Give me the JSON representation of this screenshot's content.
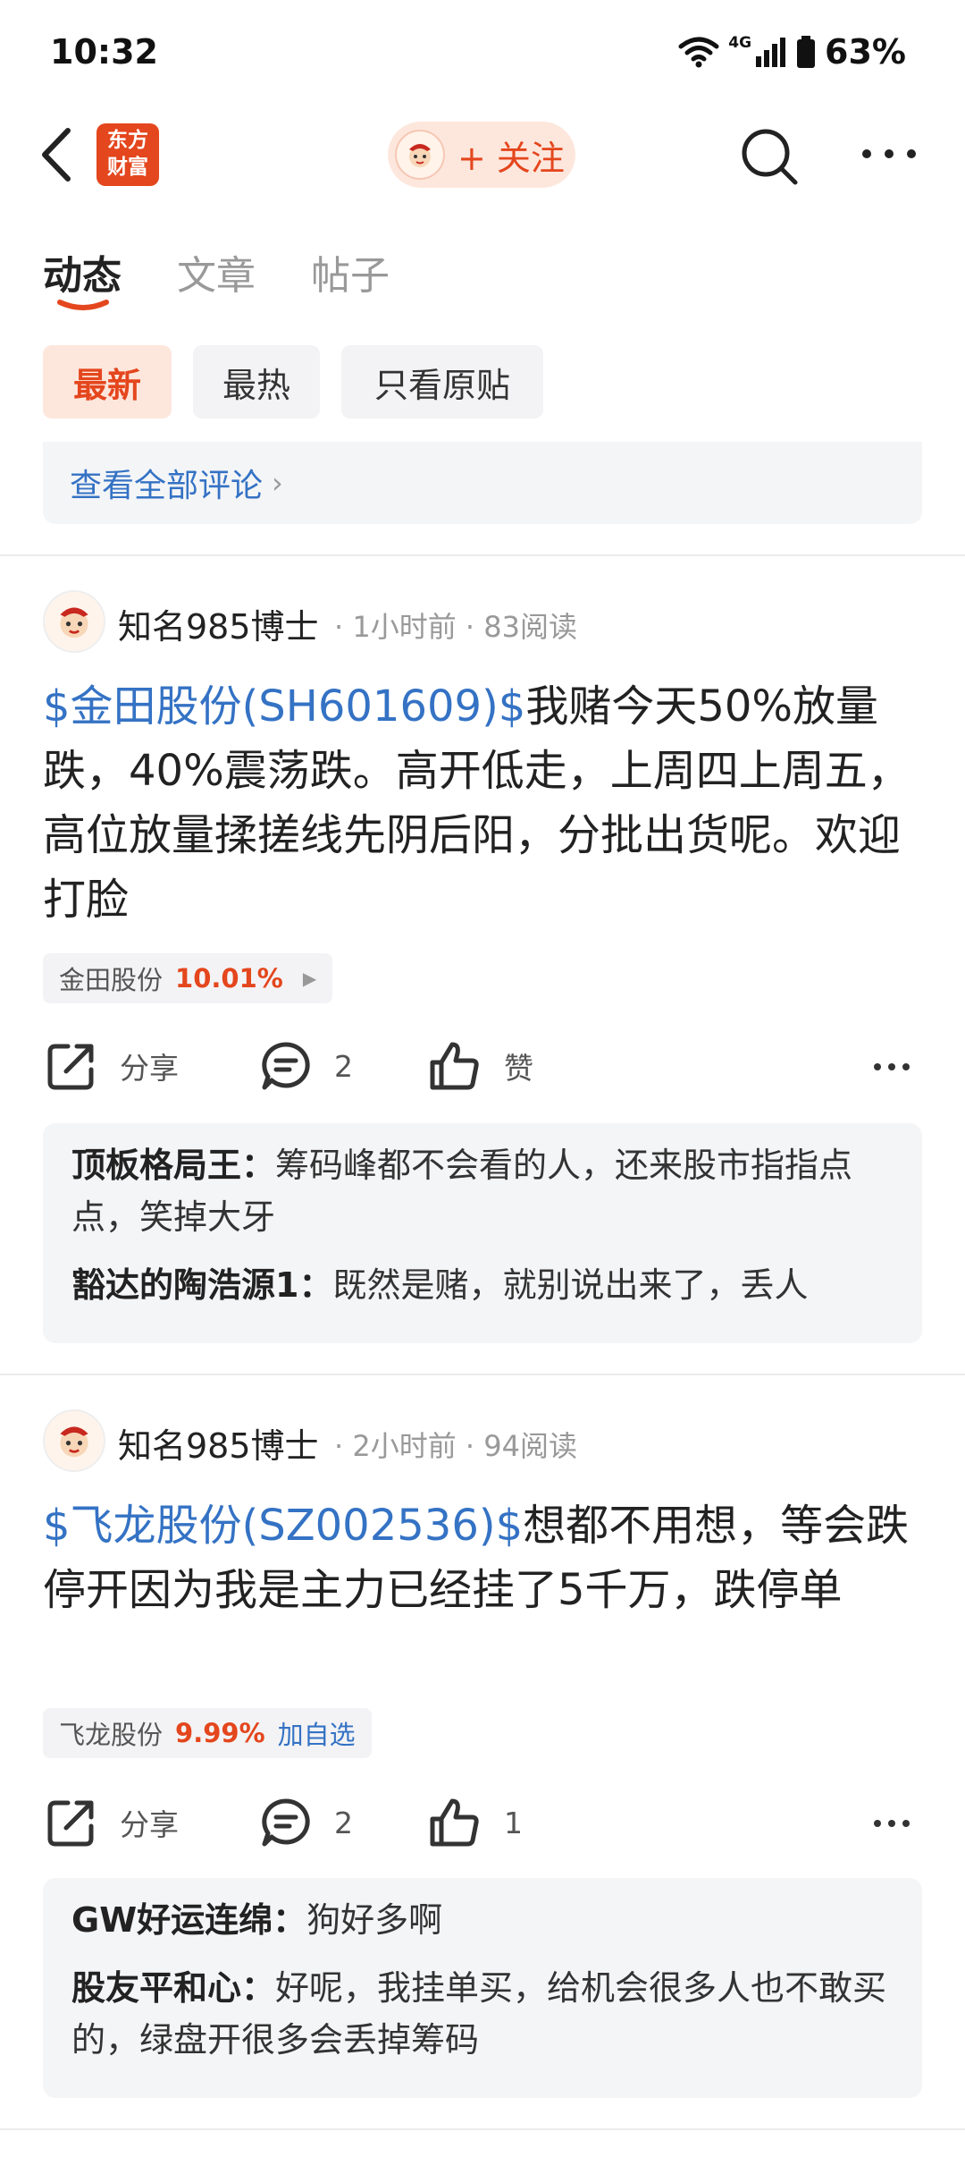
{
  "status_bar": {
    "time": "10:32",
    "network": "4G",
    "battery": "63%"
  },
  "header": {
    "logo_text_line1": "东方",
    "logo_text_line2": "财富",
    "follow_label": "+ 关注"
  },
  "tabs": [
    {
      "label": "动态"
    },
    {
      "label": "文章"
    },
    {
      "label": "帖子"
    }
  ],
  "filters": [
    {
      "label": "最新"
    },
    {
      "label": "最热"
    },
    {
      "label": "只看原贴"
    }
  ],
  "view_all_comments": "查看全部评论",
  "posts": [
    {
      "author": "知名985博士",
      "meta": "· 1小时前 · 83阅读",
      "stock_link": "$金田股份(SH601609)$",
      "text": "我赌今天50%放量跌，40%震荡跌。高开低走，上周四上周五，高位放量揉搓线先阴后阳，分批出货呢。欢迎打脸",
      "tag": {
        "name": "金田股份",
        "change": "10.01%",
        "extra": ""
      },
      "actions": {
        "share": "分享",
        "comments": "2",
        "like": "赞"
      },
      "comments": [
        {
          "name": "顶板格局王：",
          "text": "筹码峰都不会看的人，还来股市指指点点，笑掉大牙"
        },
        {
          "name": "豁达的陶浩源1：",
          "text": "既然是赌，就别说出来了，丢人"
        }
      ]
    },
    {
      "author": "知名985博士",
      "meta": "· 2小时前 · 94阅读",
      "stock_link": "$飞龙股份(SZ002536)$",
      "text": "想都不用想，等会跌停开因为我是主力已经挂了5千万，跌停单",
      "tag": {
        "name": "飞龙股份",
        "change": "9.99%",
        "extra": "加自选"
      },
      "actions": {
        "share": "分享",
        "comments": "2",
        "like": "1"
      },
      "comments": [
        {
          "name": "GW好运连绵：",
          "text": "狗好多啊"
        },
        {
          "name": "股友平和心：",
          "text": "好呢，我挂单买，给机会很多人也不敢买的，绿盘开很多会丢掉筹码"
        }
      ]
    }
  ]
}
